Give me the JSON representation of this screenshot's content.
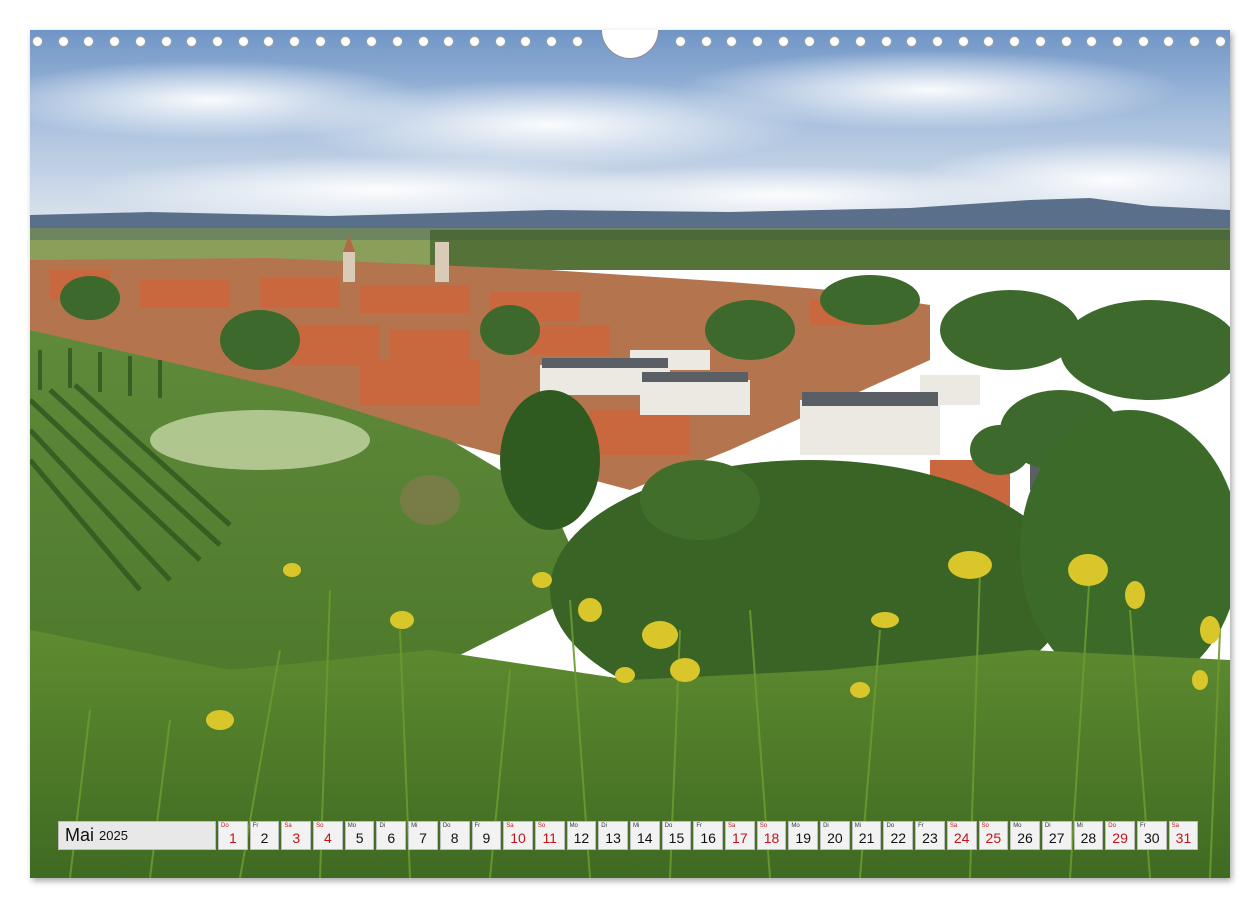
{
  "calendar": {
    "month": "Mai",
    "year": "2025",
    "days": [
      {
        "dow": "Do",
        "num": "1",
        "red": true
      },
      {
        "dow": "Fr",
        "num": "2",
        "red": false
      },
      {
        "dow": "Sa",
        "num": "3",
        "red": true
      },
      {
        "dow": "So",
        "num": "4",
        "red": true
      },
      {
        "dow": "Mo",
        "num": "5",
        "red": false
      },
      {
        "dow": "Di",
        "num": "6",
        "red": false
      },
      {
        "dow": "Mi",
        "num": "7",
        "red": false
      },
      {
        "dow": "Do",
        "num": "8",
        "red": false
      },
      {
        "dow": "Fr",
        "num": "9",
        "red": false
      },
      {
        "dow": "Sa",
        "num": "10",
        "red": true
      },
      {
        "dow": "So",
        "num": "11",
        "red": true
      },
      {
        "dow": "Mo",
        "num": "12",
        "red": false
      },
      {
        "dow": "Di",
        "num": "13",
        "red": false
      },
      {
        "dow": "Mi",
        "num": "14",
        "red": false
      },
      {
        "dow": "Do",
        "num": "15",
        "red": false
      },
      {
        "dow": "Fr",
        "num": "16",
        "red": false
      },
      {
        "dow": "Sa",
        "num": "17",
        "red": true
      },
      {
        "dow": "So",
        "num": "18",
        "red": true
      },
      {
        "dow": "Mo",
        "num": "19",
        "red": false
      },
      {
        "dow": "Di",
        "num": "20",
        "red": false
      },
      {
        "dow": "Mi",
        "num": "21",
        "red": false
      },
      {
        "dow": "Do",
        "num": "22",
        "red": false
      },
      {
        "dow": "Fr",
        "num": "23",
        "red": false
      },
      {
        "dow": "Sa",
        "num": "24",
        "red": true
      },
      {
        "dow": "So",
        "num": "25",
        "red": true
      },
      {
        "dow": "Mo",
        "num": "26",
        "red": false
      },
      {
        "dow": "Di",
        "num": "27",
        "red": false
      },
      {
        "dow": "Mi",
        "num": "28",
        "red": false
      },
      {
        "dow": "Do",
        "num": "29",
        "red": true
      },
      {
        "dow": "Fr",
        "num": "30",
        "red": false
      },
      {
        "dow": "Sa",
        "num": "31",
        "red": true
      }
    ]
  },
  "colors": {
    "holiday_red": "#c0161b",
    "sky": "#7d9fcc",
    "meadow": "#6e9a3c"
  }
}
